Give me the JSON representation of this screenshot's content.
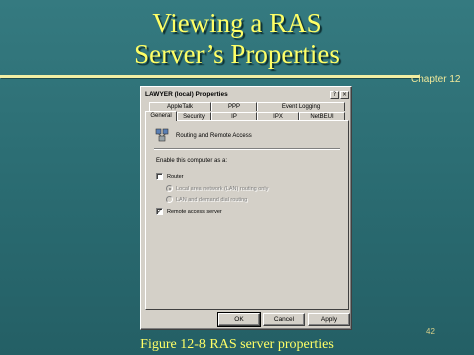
{
  "slide": {
    "title_line1": "Viewing a RAS",
    "title_line2": "Server’s Properties",
    "chapter": "Chapter 12",
    "page_number": "42",
    "caption": "Figure 12-8  RAS server properties"
  },
  "dialog": {
    "title": "LAWYER (local) Properties",
    "help_button": "?",
    "close_button": "×",
    "tabs_row1": [
      "AppleTalk",
      "PPP",
      "Event Logging"
    ],
    "tabs_row2": [
      "General",
      "Security",
      "IP",
      "IPX",
      "NetBEUI"
    ],
    "active_tab": "General",
    "heading": "Routing and Remote Access",
    "enable_label": "Enable this computer as a:",
    "router_label": "Router",
    "router_checked": false,
    "lan_only_label": "Local area network (LAN) routing only",
    "lan_dial_label": "LAN and demand dial routing",
    "remote_access_label": "Remote access server",
    "remote_access_checked": true,
    "buttons": {
      "ok": "OK",
      "cancel": "Cancel",
      "apply": "Apply"
    }
  },
  "colors": {
    "background": "#2b6e74",
    "title_text": "#ffff66",
    "rule": "#f2eea4",
    "dialog_face": "#d4d0c8"
  }
}
